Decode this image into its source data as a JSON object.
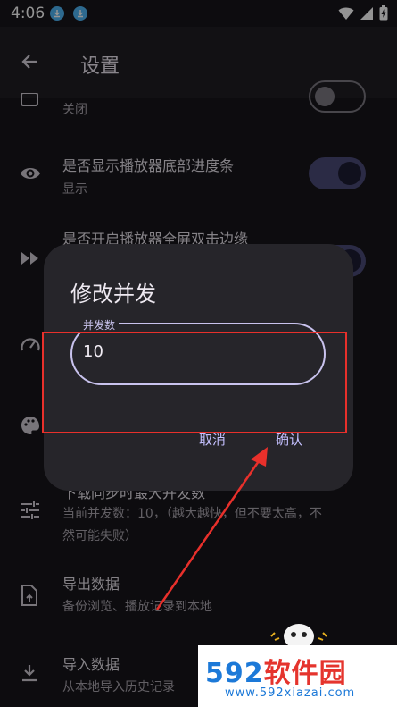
{
  "status_bar": {
    "time": "4:06"
  },
  "app_bar": {
    "title": "设置"
  },
  "settings": {
    "items": [
      {
        "title": "",
        "subtitle": "关闭"
      },
      {
        "title": "是否显示播放器底部进度条",
        "subtitle": "显示"
      },
      {
        "title": "是否开启播放器全屏双击边缘",
        "subtitle": ""
      },
      {
        "title": "下载同步时最大并发数",
        "subtitle": "当前并发数：10，（越大越快，但不要太高，不"
      },
      {
        "title": "",
        "subtitle": "然可能失败）"
      },
      {
        "title": "导出数据",
        "subtitle": "备份浏览、播放记录到本地"
      },
      {
        "title": "导入数据",
        "subtitle": "从本地导入历史记录"
      }
    ]
  },
  "dialog": {
    "title": "修改并发",
    "field_label": "并发数",
    "field_value": "10",
    "cancel_label": "取消",
    "confirm_label": "确认"
  },
  "watermark": {
    "brand_number": "592",
    "brand_text": "软件园",
    "url": "www.592xiazai.com"
  },
  "colors": {
    "accent": "#c4c0ff",
    "switch_on": "#4b4b78",
    "highlight": "#e8302b"
  }
}
